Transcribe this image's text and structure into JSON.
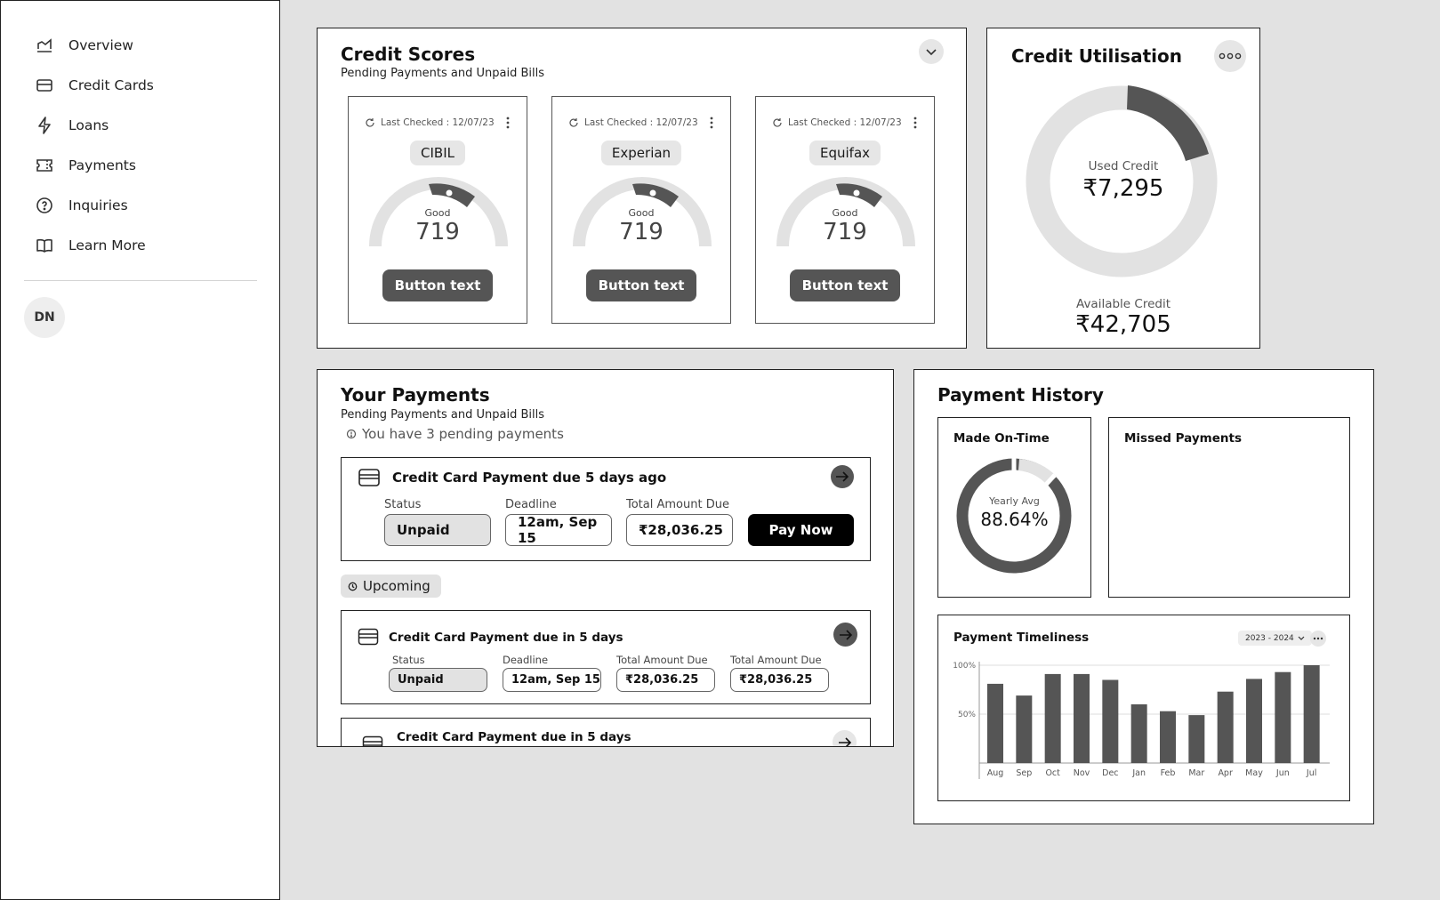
{
  "sidebar": {
    "items": [
      {
        "label": "Overview",
        "icon": "chart-icon"
      },
      {
        "label": "Credit Cards",
        "icon": "credit-card-icon"
      },
      {
        "label": "Loans",
        "icon": "lightning-icon"
      },
      {
        "label": "Payments",
        "icon": "ticket-icon"
      },
      {
        "label": "Inquiries",
        "icon": "help-circle-icon"
      },
      {
        "label": "Learn More",
        "icon": "book-icon"
      }
    ],
    "avatar_initials": "DN"
  },
  "credit_scores": {
    "title": "Credit Scores",
    "subtitle": "Pending Payments and Unpaid Bills",
    "cards": [
      {
        "last_checked": "Last Checked : 12/07/23",
        "bureau": "CIBIL",
        "rating": "Good",
        "score": "719",
        "button": "Button text"
      },
      {
        "last_checked": "Last Checked : 12/07/23",
        "bureau": "Experian",
        "rating": "Good",
        "score": "719",
        "button": "Button text"
      },
      {
        "last_checked": "Last Checked : 12/07/23",
        "bureau": "Equifax",
        "rating": "Good",
        "score": "719",
        "button": "Button text"
      }
    ]
  },
  "credit_utilisation": {
    "title": "Credit Utilisation",
    "used_label": "Used Credit",
    "used_value": "₹7,295",
    "available_label": "Available Credit",
    "available_value": "₹42,705"
  },
  "your_payments": {
    "title": "Your Payments",
    "subtitle": "Pending Payments and Unpaid Bills",
    "pending_note": "You have 3 pending payments",
    "overdue": {
      "title": "Credit Card Payment due 5 days ago",
      "status_label": "Status",
      "status_value": "Unpaid",
      "deadline_label": "Deadline",
      "deadline_value": "12am, Sep 15",
      "amount_label": "Total Amount Due",
      "amount_value": "₹28,036.25",
      "pay_button": "Pay Now"
    },
    "upcoming_tag": "Upcoming",
    "upcoming": [
      {
        "title": "Credit Card Payment due in 5 days",
        "status_label": "Status",
        "status_value": "Unpaid",
        "deadline_label": "Deadline",
        "deadline_value": "12am, Sep 15",
        "amount_label": "Total Amount Due",
        "amount_value": "₹28,036.25",
        "amount2_label": "Total Amount Due",
        "amount2_value": "₹28,036.25"
      },
      {
        "title": "Credit Card Payment due in 5 days"
      }
    ]
  },
  "payment_history": {
    "title": "Payment History",
    "made_on_time": {
      "title": "Made On-Time",
      "label": "Yearly Avg",
      "value": "88.64%"
    },
    "missed": {
      "title": "Missed Payments"
    },
    "timeliness": {
      "title": "Payment Timeliness",
      "period": "2023 - 2024"
    }
  },
  "chart_data": {
    "type": "bar",
    "title": "Payment Timeliness",
    "categories": [
      "Aug",
      "Sep",
      "Oct",
      "Nov",
      "Dec",
      "Jan",
      "Feb",
      "Mar",
      "Apr",
      "May",
      "Jun",
      "Jul"
    ],
    "values": [
      81,
      69,
      91,
      91,
      85,
      60,
      53,
      49,
      73,
      86,
      93,
      100
    ],
    "ylim": [
      0,
      100
    ],
    "yticks": [
      "100%",
      "50%"
    ],
    "grid": true,
    "bar_color": "#555555"
  },
  "colors": {
    "dark": "#555555",
    "light": "#e2e2e2",
    "black": "#000000"
  }
}
